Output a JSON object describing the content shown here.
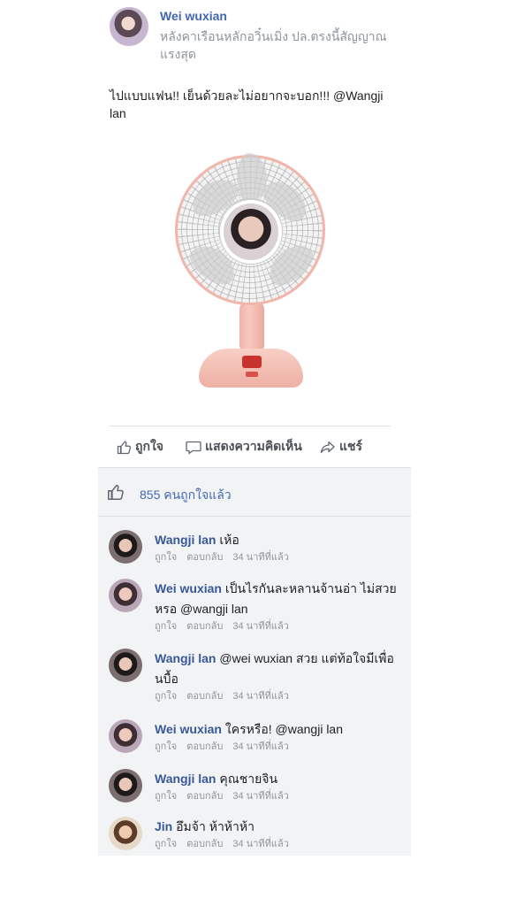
{
  "post": {
    "author": "Wei wuxian",
    "status_text": "หลังคาเรือนหลักอวิ๋นเมิ่ง ปล.ตรงนี้สัญญาณแรงสุด",
    "body": "ไปแบบแฟน!! เย็นด้วยละไม่อยากจะบอก!!! @Wangji lan"
  },
  "actions": {
    "like_label": "ถูกใจ",
    "comment_label": "แสดงความคิดเห็น",
    "share_label": "แชร์"
  },
  "likes": {
    "text": "855 คนถูกใจแล้ว"
  },
  "comments": [
    {
      "author": "Wangji lan",
      "text": "เห้อ",
      "like": "ถูกใจ",
      "reply": "ตอบกลับ",
      "time": "34 นาทีที่แล้ว"
    },
    {
      "author": "Wei wuxian",
      "text": "เป็นไรกันละหลานจ้านอ่า ไม่สวยหรอ @wangji lan",
      "like": "ถูกใจ",
      "reply": "ตอบกลับ",
      "time": "34 นาทีที่แล้ว"
    },
    {
      "author": "Wangji lan",
      "text": "@wei wuxian สวย แต่ท้อใจมีเพื่อนบื้อ",
      "like": "ถูกใจ",
      "reply": "ตอบกลับ",
      "time": "34 นาทีที่แล้ว"
    },
    {
      "author": "Wei wuxian",
      "text": "ใครหรือ! @wangji lan",
      "like": "ถูกใจ",
      "reply": "ตอบกลับ",
      "time": "34 นาทีที่แล้ว"
    },
    {
      "author": "Wangji lan",
      "text": "คุณชายจิน",
      "like": "ถูกใจ",
      "reply": "ตอบกลับ",
      "time": "34 นาทีที่แล้ว"
    },
    {
      "author": "Jin",
      "text": "อึมจ้า ห้าห้าห้า",
      "like": "ถูกใจ",
      "reply": "ตอบกลับ",
      "time": "34 นาทีที่แล้ว"
    }
  ],
  "icons": {
    "like": "thumbs-up-icon",
    "comment": "speech-bubble-icon",
    "share": "share-arrow-icon"
  },
  "colors": {
    "link_blue": "#4267b2",
    "author_blue": "#385898",
    "meta_gray": "#90949c",
    "panel_bg": "#f2f3f5"
  }
}
